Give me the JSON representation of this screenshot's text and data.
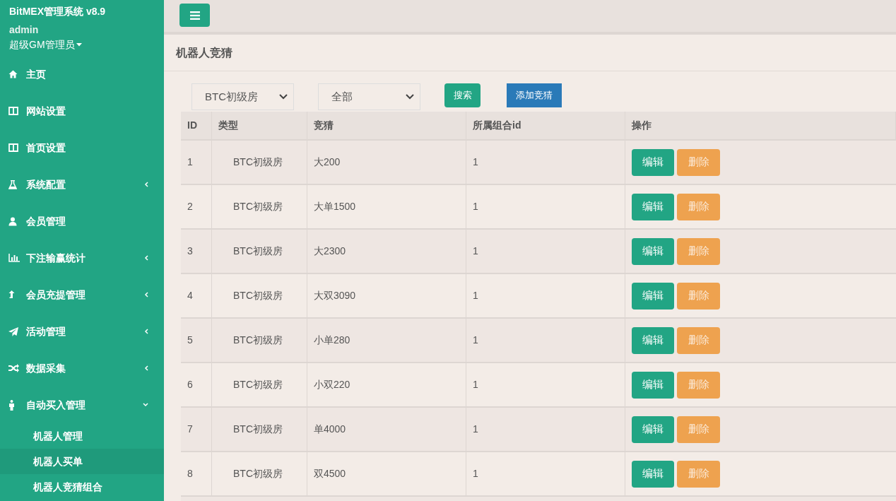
{
  "sidebar": {
    "title": "BitMEX管理系统 v8.9",
    "user": "admin",
    "role": "超级GM管理员",
    "items": [
      {
        "label": "主页",
        "kind": "link"
      },
      {
        "label": "网站设置",
        "kind": "link"
      },
      {
        "label": "首页设置",
        "kind": "link"
      },
      {
        "label": "系统配置",
        "kind": "group",
        "expanded": false
      },
      {
        "label": "会员管理",
        "kind": "link"
      },
      {
        "label": "下注输赢统计",
        "kind": "group",
        "expanded": false
      },
      {
        "label": "会员充提管理",
        "kind": "group",
        "expanded": false
      },
      {
        "label": "活动管理",
        "kind": "group",
        "expanded": false
      },
      {
        "label": "数据采集",
        "kind": "group",
        "expanded": false
      },
      {
        "label": "自动买入管理",
        "kind": "group",
        "expanded": true,
        "children": [
          {
            "label": "机器人管理",
            "selected": false
          },
          {
            "label": "机器人买单",
            "selected": true
          },
          {
            "label": "机器人竞猜组合",
            "selected": false
          }
        ]
      }
    ]
  },
  "page_title": "机器人竞猜",
  "filters": {
    "room": "BTC初级房",
    "scope": "全部",
    "search_button": "搜索",
    "add_button": "添加竞猜"
  },
  "table": {
    "columns": [
      "ID",
      "类型",
      "竞猜",
      "所属组合id",
      "操作"
    ],
    "rows": [
      {
        "id": "1",
        "type": "BTC初级房",
        "guess": "大200",
        "group_id": "1",
        "edit": "编辑",
        "delete": "删除"
      },
      {
        "id": "2",
        "type": "BTC初级房",
        "guess": "大单1500",
        "group_id": "1",
        "edit": "编辑",
        "delete": "删除"
      },
      {
        "id": "3",
        "type": "BTC初级房",
        "guess": "大2300",
        "group_id": "1",
        "edit": "编辑",
        "delete": "删除"
      },
      {
        "id": "4",
        "type": "BTC初级房",
        "guess": "大双3090",
        "group_id": "1",
        "edit": "编辑",
        "delete": "删除"
      },
      {
        "id": "5",
        "type": "BTC初级房",
        "guess": "小单280",
        "group_id": "1",
        "edit": "编辑",
        "delete": "删除"
      },
      {
        "id": "6",
        "type": "BTC初级房",
        "guess": "小双220",
        "group_id": "1",
        "edit": "编辑",
        "delete": "删除"
      },
      {
        "id": "7",
        "type": "BTC初级房",
        "guess": "单4000",
        "group_id": "1",
        "edit": "编辑",
        "delete": "删除"
      },
      {
        "id": "8",
        "type": "BTC初级房",
        "guess": "双4500",
        "group_id": "1",
        "edit": "编辑",
        "delete": "删除"
      }
    ]
  }
}
